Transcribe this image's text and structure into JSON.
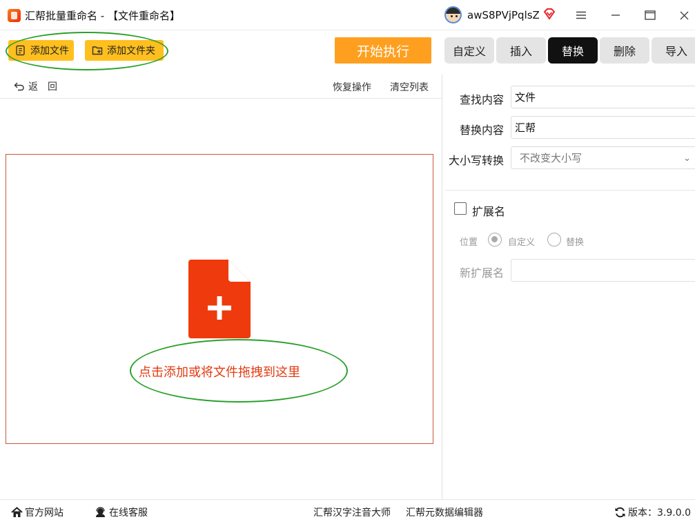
{
  "window": {
    "title": "汇帮批量重命名 - 【文件重命名】",
    "username": "awS8PVjPqlsZ",
    "controls": [
      "menu-icon",
      "minimize-icon",
      "maximize-icon",
      "close-icon"
    ]
  },
  "toolbar": {
    "add_file": "添加文件",
    "add_folder": "添加文件夹",
    "start": "开始执行",
    "tabs": [
      {
        "label": "自定义",
        "active": false
      },
      {
        "label": "插入",
        "active": false
      },
      {
        "label": "替换",
        "active": true
      },
      {
        "label": "删除",
        "active": false
      },
      {
        "label": "导入",
        "active": false
      }
    ],
    "back": "返　回",
    "restore": "恢复操作",
    "clear": "清空列表"
  },
  "dropzone": {
    "hint": "点击添加或将文件拖拽到这里"
  },
  "replace_panel": {
    "find_label": "查找内容",
    "find_value": "文件",
    "replace_label": "替换内容",
    "replace_value": "汇帮",
    "case_label": "大小写转换",
    "case_value": "不改变大小写",
    "extension_label": "扩展名",
    "extension_checked": false,
    "position_label": "位置",
    "position_options": [
      {
        "label": "自定义",
        "selected": true
      },
      {
        "label": "替换",
        "selected": false
      }
    ],
    "new_ext_label": "新扩展名",
    "new_ext_value": ""
  },
  "statusbar": {
    "website": "官方网站",
    "support": "在线客服",
    "pinyin_tool": "汇帮汉字注音大师",
    "metadata_tool": "汇帮元数据编辑器",
    "version": "版本：3.9.0.0"
  },
  "colors": {
    "accent_orange": "#ff9f1f",
    "button_yellow": "#ffbf1f",
    "drop_text": "#e23a10",
    "file_icon": "#ee3a0c",
    "annotation_green": "#2aa02a"
  }
}
